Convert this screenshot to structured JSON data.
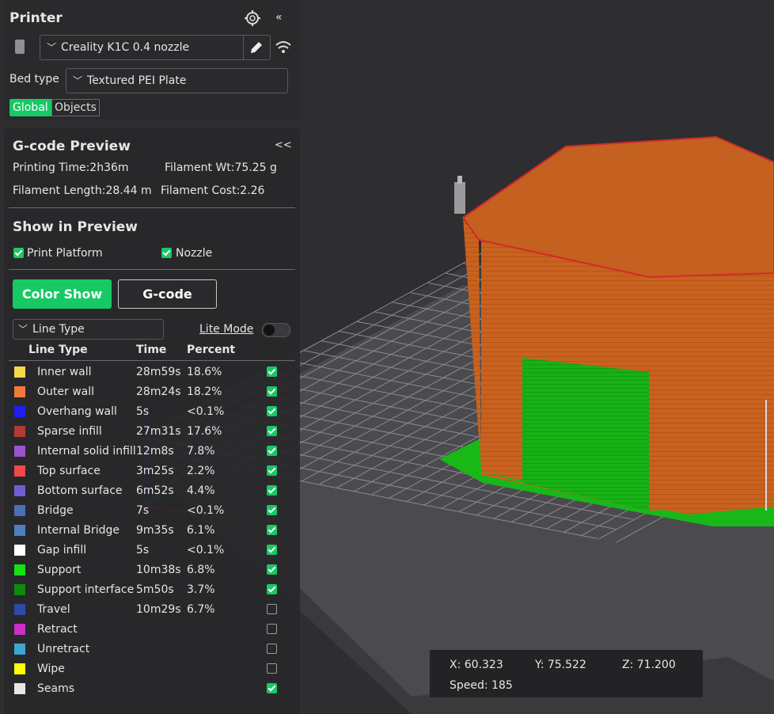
{
  "printer": {
    "title": "Printer",
    "printer_name": "Creality K1C 0.4 nozzle",
    "bed_type_label": "Bed type",
    "bed_type": "Textured PEI Plate",
    "tab_global": "Global",
    "tab_objects": "Objects"
  },
  "preview": {
    "title": "G-code Preview",
    "collapse": "<<",
    "printing_time": "Printing Time:2h36m",
    "filament_wt": "Filament Wt:75.25 g",
    "filament_length": "Filament Length:28.44 m",
    "filament_cost": "Filament Cost:2.26",
    "show_title": "Show in Preview",
    "print_platform": "Print Platform",
    "nozzle": "Nozzle",
    "color_show": "Color Show",
    "gcode": "G-code",
    "line_type_select": "Line Type",
    "lite_mode": "Lite Mode",
    "col_line_type": "Line Type",
    "col_time": "Time",
    "col_percent": "Percent"
  },
  "legend": [
    {
      "name": "Inner wall",
      "time": "28m59s",
      "percent": "18.6%",
      "color": "#f9d74b",
      "checked": true
    },
    {
      "name": "Outer wall",
      "time": "28m24s",
      "percent": "18.2%",
      "color": "#f37a3a",
      "checked": true
    },
    {
      "name": "Overhang wall",
      "time": "5s",
      "percent": "<0.1%",
      "color": "#1f1ff0",
      "checked": true
    },
    {
      "name": "Sparse infill",
      "time": "27m31s",
      "percent": "17.6%",
      "color": "#b23a32",
      "checked": true
    },
    {
      "name": "Internal solid infill",
      "time": "12m8s",
      "percent": "7.8%",
      "color": "#9a55cc",
      "checked": true
    },
    {
      "name": "Top surface",
      "time": "3m25s",
      "percent": "2.2%",
      "color": "#f24848",
      "checked": true
    },
    {
      "name": "Bottom surface",
      "time": "6m52s",
      "percent": "4.4%",
      "color": "#6d5fd0",
      "checked": true
    },
    {
      "name": "Bridge",
      "time": "7s",
      "percent": "<0.1%",
      "color": "#4a6fb5",
      "checked": true
    },
    {
      "name": "Internal Bridge",
      "time": "9m35s",
      "percent": "6.1%",
      "color": "#4f7fc0",
      "checked": true
    },
    {
      "name": "Gap infill",
      "time": "5s",
      "percent": "<0.1%",
      "color": "#ffffff",
      "checked": true
    },
    {
      "name": "Support",
      "time": "10m38s",
      "percent": "6.8%",
      "color": "#17e017",
      "checked": true
    },
    {
      "name": "Support interface",
      "time": "5m50s",
      "percent": "3.7%",
      "color": "#0f8a0f",
      "checked": true
    },
    {
      "name": "Travel",
      "time": "10m29s",
      "percent": "6.7%",
      "color": "#2f4aa8",
      "checked": false
    },
    {
      "name": "Retract",
      "time": "",
      "percent": "",
      "color": "#cc2ec6",
      "checked": false
    },
    {
      "name": "Unretract",
      "time": "",
      "percent": "",
      "color": "#3fa6cf",
      "checked": false
    },
    {
      "name": "Wipe",
      "time": "",
      "percent": "",
      "color": "#ffff00",
      "checked": false
    },
    {
      "name": "Seams",
      "time": "",
      "percent": "",
      "color": "#e8e8e8",
      "checked": true
    }
  ],
  "status": {
    "x": "X: 60.323",
    "y": "Y: 75.522",
    "z": "Z: 71.200",
    "speed": "Speed: 185"
  },
  "icons": [
    "gear-icon",
    "collapse-icon",
    "printer-device-icon",
    "chevron-down-icon",
    "pencil-edit-icon",
    "wifi-icon"
  ]
}
